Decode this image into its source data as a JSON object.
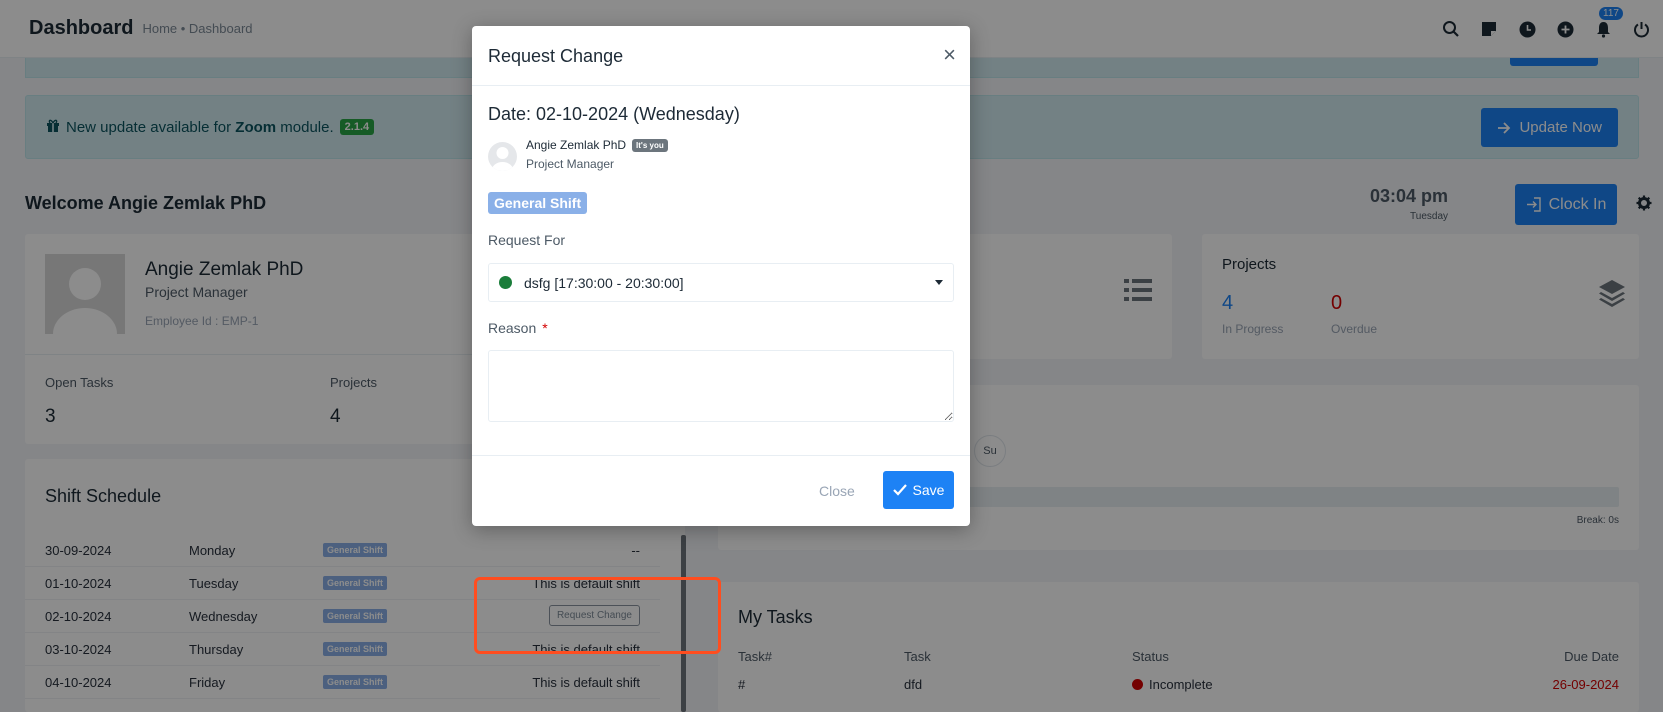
{
  "topbar": {
    "title": "Dashboard",
    "breadcrumb": "Home • Dashboard",
    "notification_count": "117",
    "icons": [
      "search-icon",
      "sticky-note-icon",
      "clock-icon",
      "plus-circle-icon",
      "bell-icon",
      "power-icon"
    ]
  },
  "alert": {
    "prefix": "New update available for ",
    "module": "Zoom",
    "suffix": " module.",
    "version": "2.1.4",
    "button": "Update Now"
  },
  "welcome": {
    "text": "Welcome Angie Zemlak PhD",
    "time": "03:04 pm",
    "day": "Tuesday",
    "clock_in": "Clock In"
  },
  "profile": {
    "name": "Angie Zemlak PhD",
    "role": "Project Manager",
    "employee_id": "Employee Id : EMP-1",
    "stats": [
      {
        "label": "Open Tasks",
        "value": "3"
      },
      {
        "label": "Projects",
        "value": "4"
      }
    ]
  },
  "projects_card": {
    "title": "Projects",
    "in_progress": "4",
    "in_progress_label": "In Progress",
    "overdue": "0",
    "overdue_label": "Overdue"
  },
  "attendance": {
    "day_label": "Su",
    "break": "Break: 0s"
  },
  "shift_schedule": {
    "title": "Shift Schedule",
    "rows": [
      {
        "date": "30-09-2024",
        "day": "Monday",
        "shift": "General Shift",
        "note": "--"
      },
      {
        "date": "01-10-2024",
        "day": "Tuesday",
        "shift": "General Shift",
        "note": "This is default shift"
      },
      {
        "date": "02-10-2024",
        "day": "Wednesday",
        "shift": "General Shift",
        "note": "Request Change"
      },
      {
        "date": "03-10-2024",
        "day": "Thursday",
        "shift": "General Shift",
        "note": "This is default shift"
      },
      {
        "date": "04-10-2024",
        "day": "Friday",
        "shift": "General Shift",
        "note": "This is default shift"
      }
    ]
  },
  "tasks": {
    "title": "My Tasks",
    "headers": [
      "Task#",
      "Task",
      "Status",
      "Due Date"
    ],
    "row": {
      "num": "#",
      "task": "dfd",
      "status": "Incomplete",
      "due": "26-09-2024"
    }
  },
  "modal": {
    "title": "Request Change",
    "date": "Date: 02-10-2024 (Wednesday)",
    "user_name": "Angie Zemlak PhD",
    "you_badge": "It's you",
    "user_role": "Project Manager",
    "shift_badge": "General Shift",
    "request_for_label": "Request For",
    "request_for_value": "dsfg [17:30:00 - 20:30:00]",
    "reason_label": "Reason",
    "required_mark": "*",
    "close": "Close",
    "save": "Save"
  },
  "colors": {
    "primary": "#1d82f5",
    "danger": "#d30000",
    "success": "#1a7d3a",
    "highlight": "#ff4d1f"
  }
}
